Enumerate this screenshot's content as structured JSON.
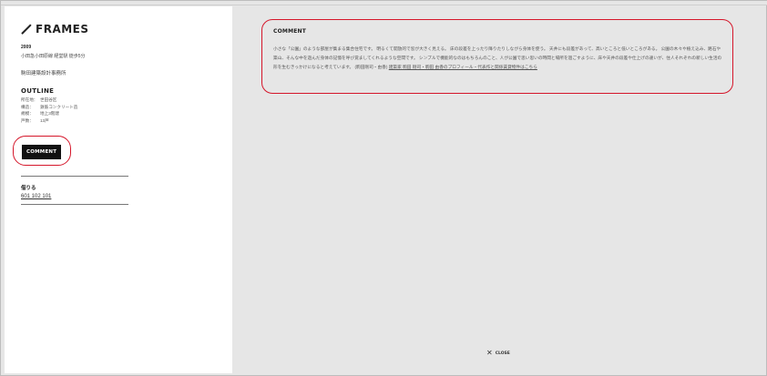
{
  "top_ghost_text": "",
  "brand": {
    "name": "FRAMES"
  },
  "project": {
    "year": "2009",
    "station": "小田急小田原線 経堂駅 徒歩5分",
    "architect": "駒田建築設計事務所"
  },
  "outline": {
    "title": "OUTLINE",
    "rows": [
      {
        "key": "所在地：",
        "value": "世田谷区"
      },
      {
        "key": "構造：",
        "value": "鉄筋コンクリート造"
      },
      {
        "key": "規模：",
        "value": "地上3階建"
      },
      {
        "key": "戸数：",
        "value": "13戸"
      }
    ]
  },
  "comment_button": {
    "label": "COMMENT"
  },
  "rent": {
    "title": "借りる",
    "phone": "601 102 101"
  },
  "comment": {
    "title": "COMMENT",
    "body": "小さな「公園」のような部屋が集まる集合住宅です。 明るくて開放的で窓が大きく見える。 床の段差を上ったり降りたりしながら身体を使う。 天井にも段差があって、高いところと低いところがある。 公園の木々や植え込み、路石や築山、そんな中を遊んだ身体の記憶を呼び覚ましてくれるような空間です。 シンプルで機能的なのはもちろんのこと、人が公園で思い思いの時間と場所を過ごすように、床や天井の段差や仕上げの違いが、住人それぞれの新しい生活の形を生むきっかけになると考えています。 (駒田剛司・由香) ",
    "link": "建築家 駒田 剛司・駒田 由香のプロフィール・代表作と関係賃貸物件はこちら"
  },
  "close": {
    "label": "CLOSE",
    "icon": "close-icon"
  },
  "colors": {
    "accent_circle": "#d5162a",
    "button_bg": "#111111"
  }
}
